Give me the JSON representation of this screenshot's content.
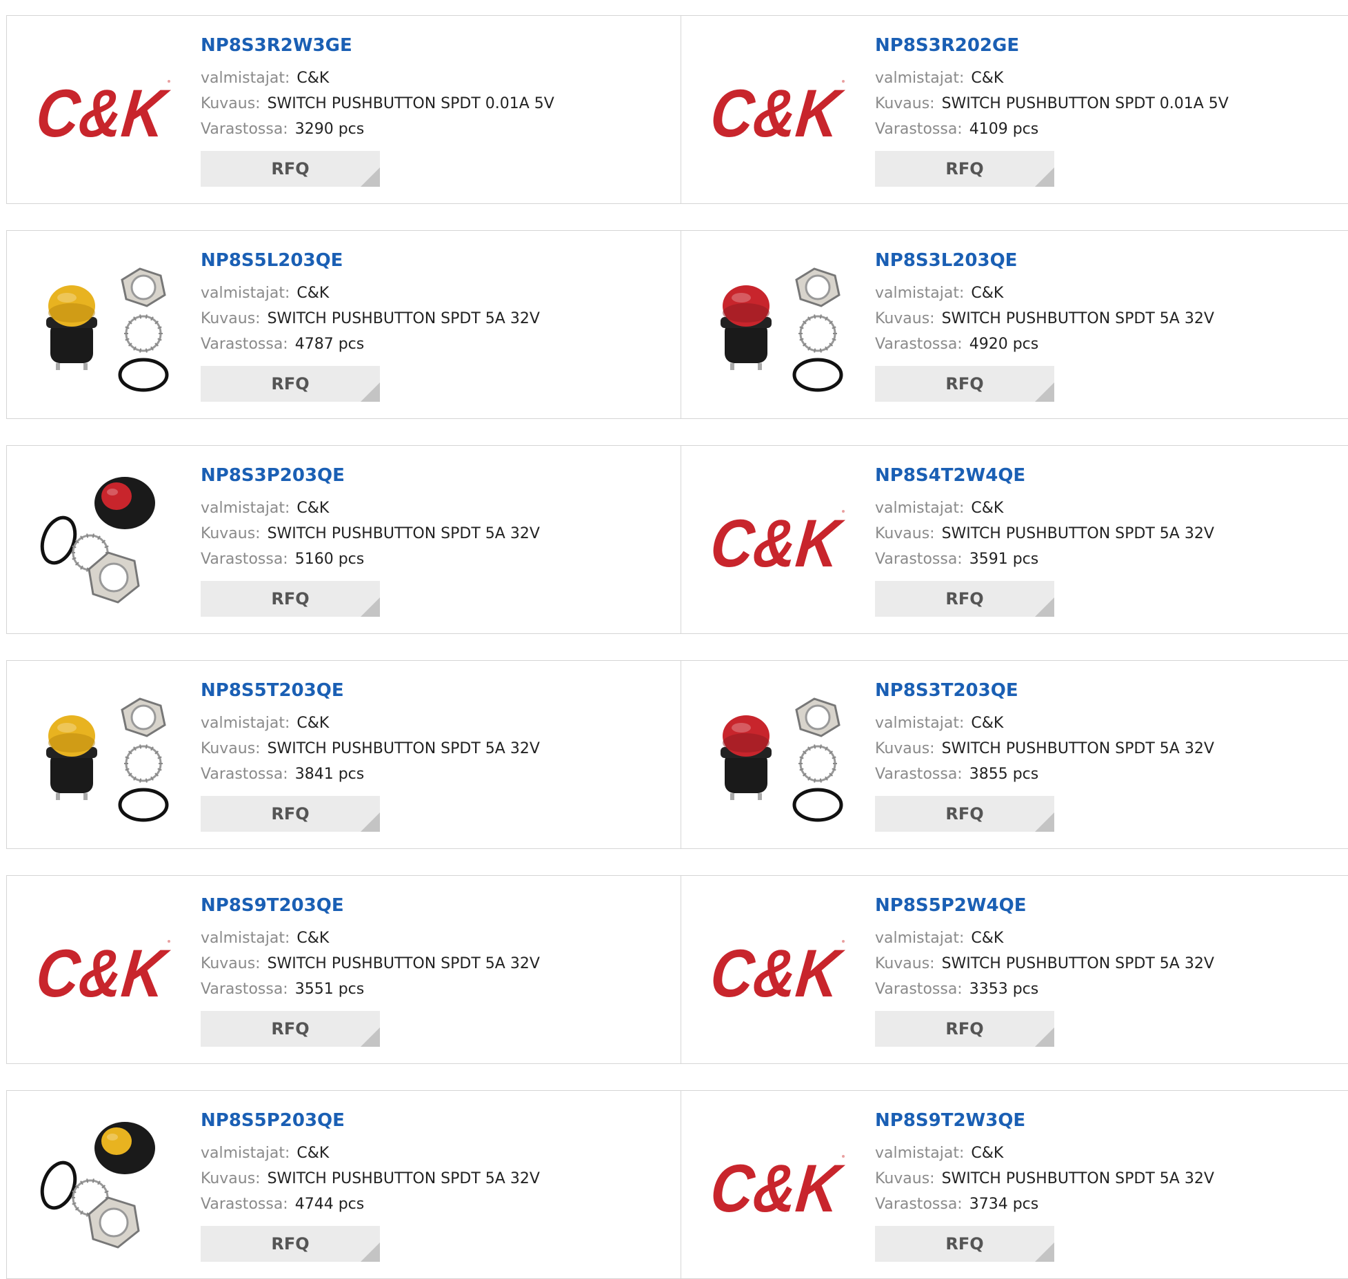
{
  "labels": {
    "manufacturer": "valmistajat:",
    "description": "Kuvaus:",
    "stock": "Varastossa:",
    "rfq": "RFQ"
  },
  "brand": {
    "logo_text": "C&K",
    "logo_color": "#c8252c"
  },
  "products": [
    {
      "part": "NP8S3R2W3GE",
      "manufacturer": "C&K",
      "description": "SWITCH PUSHBUTTON SPDT 0.01A 5V",
      "stock": "3290 pcs",
      "image": "ck-logo"
    },
    {
      "part": "NP8S3R202GE",
      "manufacturer": "C&K",
      "description": "SWITCH PUSHBUTTON SPDT 0.01A 5V",
      "stock": "4109 pcs",
      "image": "ck-logo"
    },
    {
      "part": "NP8S5L203QE",
      "manufacturer": "C&K",
      "description": "SWITCH PUSHBUTTON SPDT 5A 32V",
      "stock": "4787 pcs",
      "image": "switch-yellow"
    },
    {
      "part": "NP8S3L203QE",
      "manufacturer": "C&K",
      "description": "SWITCH PUSHBUTTON SPDT 5A 32V",
      "stock": "4920 pcs",
      "image": "switch-red"
    },
    {
      "part": "NP8S3P203QE",
      "manufacturer": "C&K",
      "description": "SWITCH PUSHBUTTON SPDT 5A 32V",
      "stock": "5160 pcs",
      "image": "switch-red-angled"
    },
    {
      "part": "NP8S4T2W4QE",
      "manufacturer": "C&K",
      "description": "SWITCH PUSHBUTTON SPDT 5A 32V",
      "stock": "3591 pcs",
      "image": "ck-logo"
    },
    {
      "part": "NP8S5T203QE",
      "manufacturer": "C&K",
      "description": "SWITCH PUSHBUTTON SPDT 5A 32V",
      "stock": "3841 pcs",
      "image": "switch-yellow"
    },
    {
      "part": "NP8S3T203QE",
      "manufacturer": "C&K",
      "description": "SWITCH PUSHBUTTON SPDT 5A 32V",
      "stock": "3855 pcs",
      "image": "switch-red"
    },
    {
      "part": "NP8S9T203QE",
      "manufacturer": "C&K",
      "description": "SWITCH PUSHBUTTON SPDT 5A 32V",
      "stock": "3551 pcs",
      "image": "ck-logo"
    },
    {
      "part": "NP8S5P2W4QE",
      "manufacturer": "C&K",
      "description": "SWITCH PUSHBUTTON SPDT 5A 32V",
      "stock": "3353 pcs",
      "image": "ck-logo"
    },
    {
      "part": "NP8S5P203QE",
      "manufacturer": "C&K",
      "description": "SWITCH PUSHBUTTON SPDT 5A 32V",
      "stock": "4744 pcs",
      "image": "switch-yellow-angled"
    },
    {
      "part": "NP8S9T2W3QE",
      "manufacturer": "C&K",
      "description": "SWITCH PUSHBUTTON SPDT 5A 32V",
      "stock": "3734 pcs",
      "image": "ck-logo"
    }
  ]
}
